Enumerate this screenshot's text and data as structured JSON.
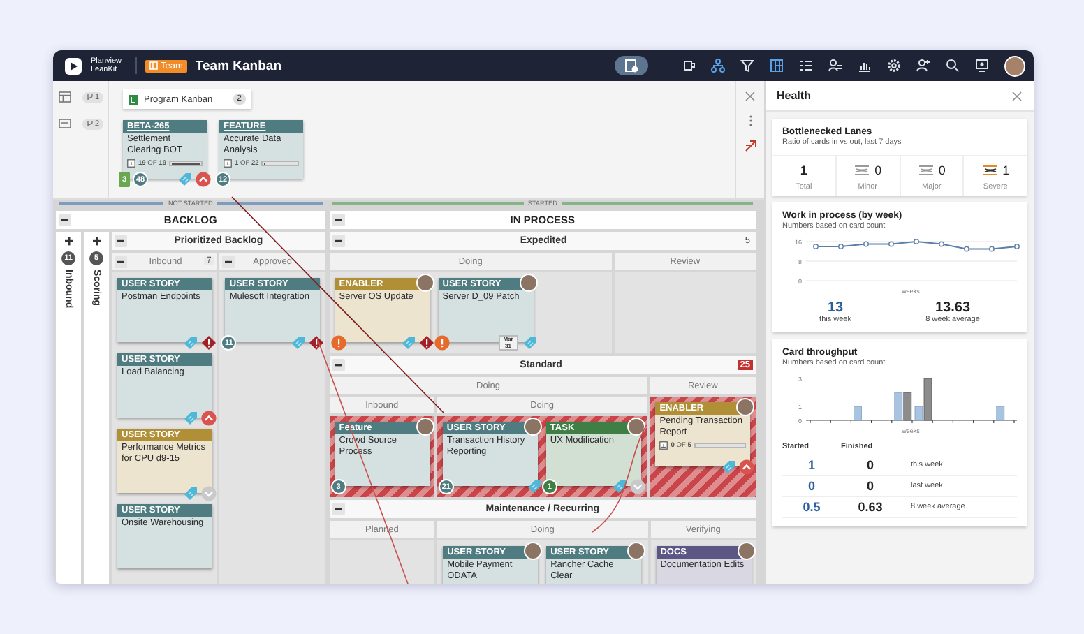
{
  "topbar": {
    "logo": "Planview LeanKit",
    "team": "Team",
    "title": "Team Kanban"
  },
  "links": {
    "filters": [
      {
        "kind": "table",
        "count": "1"
      },
      {
        "kind": "card",
        "count": "2"
      }
    ],
    "board_link": {
      "name": "Program Kanban",
      "count": "2"
    },
    "cards": [
      {
        "type": "BETA-265",
        "title": "Settlement Clearing BOT",
        "color": "#4f7c80",
        "progress": "**19** OF **19**",
        "level": 1,
        "badges": [
          {
            "kind": "count-square",
            "text": "3"
          },
          {
            "kind": "count",
            "text": "48"
          },
          {
            "kind": "tag"
          },
          {
            "kind": "priority-high"
          }
        ]
      },
      {
        "type": "FEATURE",
        "title": "Accurate Data Analysis",
        "color": "#4f7c80",
        "progress": "**1** OF **22**",
        "level": 0.05,
        "badges": [
          {
            "kind": "count",
            "text": "12"
          }
        ]
      }
    ]
  },
  "board": {
    "sections": [
      {
        "kind": "section",
        "title": "BACKLOG",
        "expanded": true,
        "phase": {
          "label": "NOT STARTED",
          "color": "#7f9bbd"
        },
        "columns": [
          {
            "kind": "collapsed",
            "title": "Inbound",
            "count": "11",
            "expanded": false
          },
          {
            "kind": "collapsed",
            "title": "Scoring",
            "count": "5",
            "expanded": false
          },
          {
            "kind": "lane",
            "title": "Prioritized Backlog",
            "expanded": true,
            "columns": [
              {
                "kind": "column",
                "title": "Inbound",
                "count": "7",
                "expanded": true,
                "cards": [
                  {
                    "type": "USER STORY",
                    "title": "Postman Endpoints",
                    "color": "#4f7c80",
                    "badges": [
                      {
                        "kind": "tag"
                      },
                      {
                        "kind": "blocked"
                      }
                    ]
                  },
                  {
                    "type": "USER STORY",
                    "title": "Load Balancing",
                    "color": "#4f7c80",
                    "badges": [
                      {
                        "kind": "tag"
                      },
                      {
                        "kind": "priority-high"
                      }
                    ]
                  },
                  {
                    "type": "USER STORY",
                    "title": "Performance Metrics for CPU d9-15",
                    "color": "#b08f36",
                    "badges": [
                      {
                        "kind": "tag"
                      },
                      {
                        "kind": "priority-low"
                      }
                    ]
                  },
                  {
                    "type": "USER STORY",
                    "title": "Onsite Warehousing",
                    "color": "#4f7c80"
                  }
                ]
              },
              {
                "kind": "column",
                "title": "Approved",
                "expanded": true,
                "cards": [
                  {
                    "type": "USER STORY",
                    "title": "Mulesoft Integration",
                    "color": "#4f7c80",
                    "badges": [
                      {
                        "kind": "count",
                        "text": "11"
                      },
                      {
                        "kind": "tag"
                      },
                      {
                        "kind": "blocked"
                      }
                    ]
                  }
                ]
              }
            ]
          }
        ]
      },
      {
        "kind": "section",
        "title": "IN PROCESS",
        "expanded": true,
        "phase": {
          "label": "STARTED",
          "color": "#86b486"
        },
        "lanes": [
          {
            "kind": "lane",
            "title": "Expedited",
            "count": "5",
            "over_limit": false,
            "expanded": true,
            "columns": [
              {
                "kind": "column",
                "title": "Doing",
                "cards": [
                  {
                    "type": "ENABLER",
                    "title": "Server OS Update",
                    "color": "#b08f36",
                    "avatar": true,
                    "badges": [
                      {
                        "kind": "alert"
                      },
                      {
                        "kind": "tag"
                      },
                      {
                        "kind": "blocked"
                      }
                    ]
                  },
                  {
                    "type": "USER STORY",
                    "title": "Server D_09 Patch",
                    "color": "#4f7c80",
                    "avatar": true,
                    "badges": [
                      {
                        "kind": "alert"
                      },
                      {
                        "kind": "date",
                        "text": "Mar 31"
                      },
                      {
                        "kind": "tag"
                      }
                    ]
                  }
                ]
              },
              {
                "kind": "column",
                "title": "Review"
              }
            ]
          },
          {
            "kind": "lane",
            "title": "Standard",
            "count": "25",
            "over_limit": true,
            "expanded": true,
            "columns": [
              {
                "kind": "column",
                "title": "Doing",
                "columns": [
                  {
                    "kind": "column",
                    "title": "Inbound",
                    "cards": [
                      {
                        "type": "Feature",
                        "title": "Crowd Source Process",
                        "color": "#4f7c80",
                        "avatar": true,
                        "badges": [
                          {
                            "kind": "count",
                            "text": "3"
                          }
                        ]
                      }
                    ]
                  },
                  {
                    "kind": "column",
                    "title": "Doing",
                    "cards": [
                      {
                        "type": "USER STORY",
                        "title": "Transaction History Reporting",
                        "color": "#4f7c80",
                        "avatar": true,
                        "badges": [
                          {
                            "kind": "count",
                            "text": "21"
                          },
                          {
                            "kind": "tag"
                          }
                        ]
                      },
                      {
                        "type": "TASK",
                        "title": "UX Modification",
                        "color": "#3f7f45",
                        "avatar": true,
                        "badges": [
                          {
                            "kind": "count",
                            "text": "1"
                          },
                          {
                            "kind": "tag"
                          },
                          {
                            "kind": "priority-low"
                          }
                        ]
                      }
                    ]
                  }
                ]
              },
              {
                "kind": "column",
                "title": "Review",
                "cards": [
                  {
                    "type": "ENABLER",
                    "title": "Pending Transaction Report",
                    "color": "#b08f36",
                    "avatar": true,
                    "progress": "**0** OF **5**",
                    "level": 0,
                    "badges": [
                      {
                        "kind": "tag"
                      },
                      {
                        "kind": "priority-high"
                      }
                    ]
                  }
                ]
              }
            ]
          },
          {
            "kind": "lane",
            "title": "Maintenance / Recurring",
            "expanded": true,
            "columns": [
              {
                "kind": "column",
                "title": "Planned"
              },
              {
                "kind": "column",
                "title": "Doing",
                "cards": [
                  {
                    "type": "USER STORY",
                    "title": "Mobile Payment ODATA",
                    "color": "#4f7c80",
                    "avatar": true
                  },
                  {
                    "type": "USER STORY",
                    "title": "Rancher Cache Clear",
                    "color": "#4f7c80",
                    "avatar": true
                  }
                ]
              },
              {
                "kind": "column",
                "title": "Verifying",
                "cards": [
                  {
                    "type": "DOCS",
                    "title": "Documentation Edits",
                    "color": "#5b5785",
                    "avatar": true
                  }
                ]
              }
            ]
          }
        ]
      }
    ]
  },
  "health": {
    "title": "Health",
    "bottleneck": {
      "title": "Bottlenecked Lanes",
      "subtitle": "Ratio of cards in vs out, last 7 days",
      "stats": [
        {
          "kind": "total",
          "value": "1",
          "label": "Total"
        },
        {
          "kind": "minor",
          "value": "0",
          "label": "Minor"
        },
        {
          "kind": "major",
          "value": "0",
          "label": "Major"
        },
        {
          "kind": "severe",
          "value": "1",
          "label": "Severe"
        }
      ]
    },
    "wip": {
      "title": "Work in process (by week)",
      "subtitle": "Numbers based on card count",
      "chart_data": {
        "type": "line",
        "xlabel": "weeks",
        "ylim": [
          0,
          16
        ],
        "yticks": [
          0,
          8,
          16
        ],
        "series": [
          {
            "color": "#5b7fa6",
            "marker": "circle",
            "values": [
              14,
              14,
              15,
              15,
              16,
              15,
              13,
              13,
              14
            ]
          }
        ]
      },
      "stats": [
        {
          "value": "13",
          "label": "this week"
        },
        {
          "value": "13.63",
          "label": "8 week average"
        }
      ]
    },
    "throughput": {
      "title": "Card throughput",
      "subtitle": "Numbers based on card count",
      "chart_data": {
        "type": "bar",
        "xlabel": "weeks",
        "ylim": [
          0,
          3
        ],
        "yticks": [
          0,
          1,
          3
        ],
        "series": [
          {
            "color": "#a9c4e0",
            "values": [
              0,
              0,
              1,
              0,
              2,
              1,
              0,
              0,
              0,
              1
            ]
          },
          {
            "color": "#8c8c8c",
            "values": [
              0,
              0,
              0,
              0,
              2,
              3,
              0,
              0,
              0,
              0
            ]
          }
        ]
      },
      "columns": [
        "Started",
        "Finished"
      ],
      "rows": [
        {
          "started": "1",
          "finished": "0",
          "label": "this week"
        },
        {
          "started": "0",
          "finished": "0",
          "label": "last week"
        },
        {
          "started": "0.5",
          "finished": "0.63",
          "label": "8 week average"
        }
      ]
    }
  }
}
